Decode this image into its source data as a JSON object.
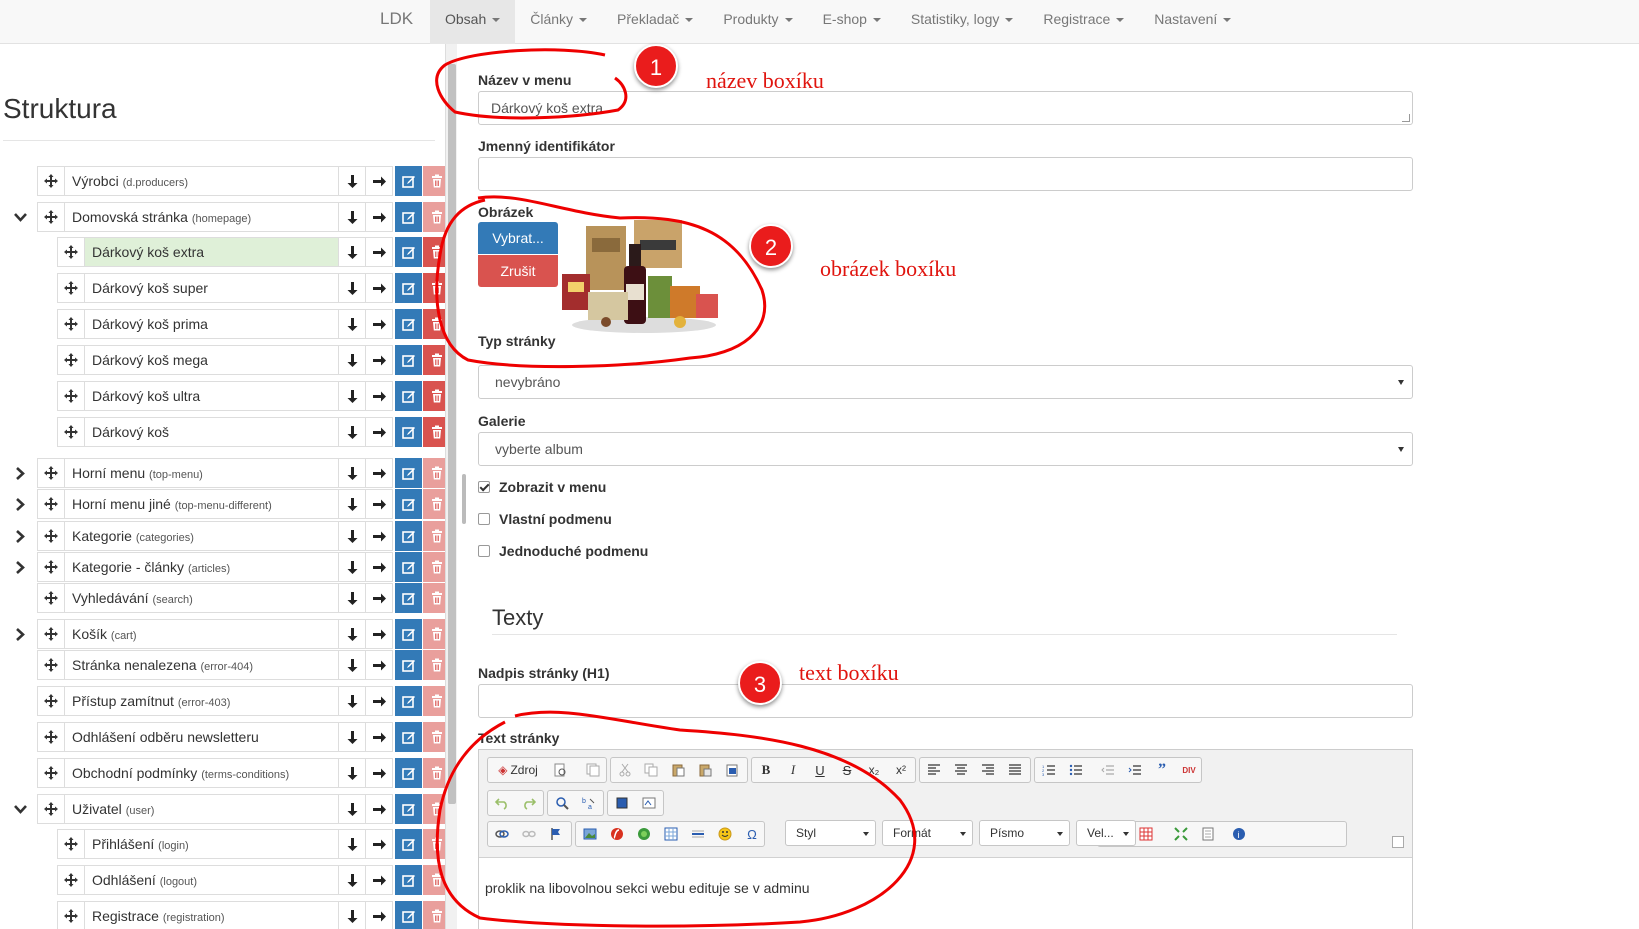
{
  "nav": {
    "brand": "LDK",
    "items": [
      "Obsah",
      "Články",
      "Překladač",
      "Produkty",
      "E-shop",
      "Statistiky, logy",
      "Registrace",
      "Nastavení"
    ]
  },
  "tree": {
    "title": "Struktura",
    "items": [
      {
        "label": "Výrobci",
        "id": "(d.producers)"
      },
      {
        "label": "Domovská stránka",
        "id": "(homepage)"
      },
      {
        "label": "Dárkový koš extra",
        "id": ""
      },
      {
        "label": "Dárkový koš super",
        "id": ""
      },
      {
        "label": "Dárkový koš prima",
        "id": ""
      },
      {
        "label": "Dárkový koš mega",
        "id": ""
      },
      {
        "label": "Dárkový koš ultra",
        "id": ""
      },
      {
        "label": "Dárkový koš",
        "id": ""
      },
      {
        "label": "Horní menu",
        "id": "(top-menu)"
      },
      {
        "label": "Horní menu jiné",
        "id": "(top-menu-different)"
      },
      {
        "label": "Kategorie",
        "id": "(categories)"
      },
      {
        "label": "Kategorie - články",
        "id": "(articles)"
      },
      {
        "label": "Vyhledávání",
        "id": "(search)"
      },
      {
        "label": "Košík",
        "id": "(cart)"
      },
      {
        "label": "Stránka nenalezena",
        "id": "(error-404)"
      },
      {
        "label": "Přístup zamítnut",
        "id": "(error-403)"
      },
      {
        "label": "Odhlášení odběru newsletteru",
        "id": ""
      },
      {
        "label": "Obchodní podmínky",
        "id": "(terms-conditions)"
      },
      {
        "label": "Uživatel",
        "id": "(user)"
      },
      {
        "label": "Přihlášení",
        "id": "(login)"
      },
      {
        "label": "Odhlášení",
        "id": "(logout)"
      },
      {
        "label": "Registrace",
        "id": "(registration)"
      }
    ]
  },
  "form": {
    "menu_name_label": "Název v menu",
    "menu_name_value": "Dárkový koš extra",
    "identifier_label": "Jmenný identifikátor",
    "identifier_value": "",
    "image_label": "Obrázek",
    "choose_button": "Vybrat...",
    "cancel_button": "Zrušit",
    "page_type_label": "Typ stránky",
    "page_type_value": "nevybráno",
    "gallery_label": "Galerie",
    "gallery_value": "vyberte album",
    "checkboxes": [
      {
        "label": "Zobrazit v menu",
        "checked": true
      },
      {
        "label": "Vlastní podmenu",
        "checked": false
      },
      {
        "label": "Jednoduché podmenu",
        "checked": false
      }
    ],
    "section_title": "Texty",
    "h1_label": "Nadpis stránky (H1)",
    "h1_value": "",
    "text_label": "Text stránky"
  },
  "editor": {
    "source_label": "Zdroj",
    "combo_style": "Styl",
    "combo_format": "Formát",
    "combo_font": "Písmo",
    "combo_size": "Vel...",
    "content": "proklik na libovolnou sekci webu edituje se v adminu"
  },
  "annotations": {
    "badge1": "1",
    "badge2": "2",
    "badge3": "3",
    "note1": "název boxíku",
    "note2": "obrázek boxíku",
    "note3": "text boxíku",
    "color": "#e0140e"
  }
}
